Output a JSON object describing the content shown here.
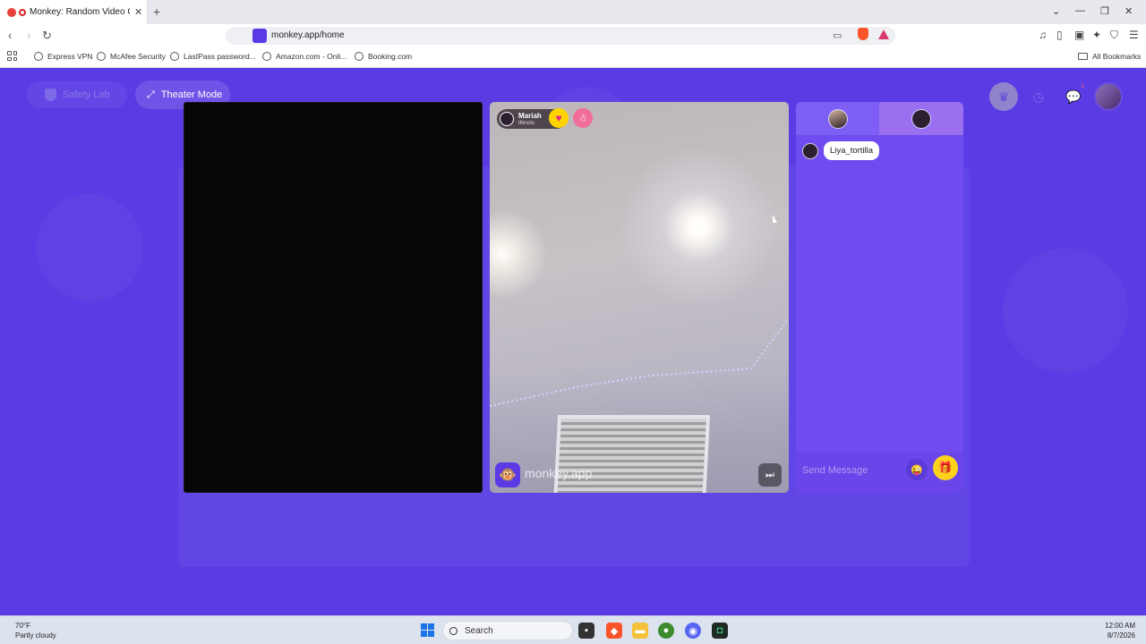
{
  "browser": {
    "tab_title": "Monkey: Random Video Chat",
    "url": "monkey.app/home",
    "bookmarks": [
      "Express VPN",
      "McAfee Security",
      "LastPass password...",
      "Amazon.com - Onli...",
      "Booking.com"
    ],
    "all_bookmarks": "All Bookmarks"
  },
  "app": {
    "safety_lab": "Safety Lab",
    "theater_mode": "Theater Mode",
    "chats_badge": "1",
    "partner": {
      "name": "Mariah",
      "location": "Illinois"
    },
    "watermark": "monkey.app",
    "chat": {
      "messages": [
        {
          "text": "Liya_tortilla"
        }
      ],
      "send_placeholder": "Send Message"
    }
  },
  "taskbar": {
    "weather_temp": "70°F",
    "weather_desc": "Partly cloudy",
    "search_label": "Search",
    "time": "12:00 AM",
    "date": "8/7/2026"
  },
  "colors": {
    "brand": "#5b3ae6",
    "chat_panel": "#6e4cf0",
    "gift": "#ffd31c"
  }
}
